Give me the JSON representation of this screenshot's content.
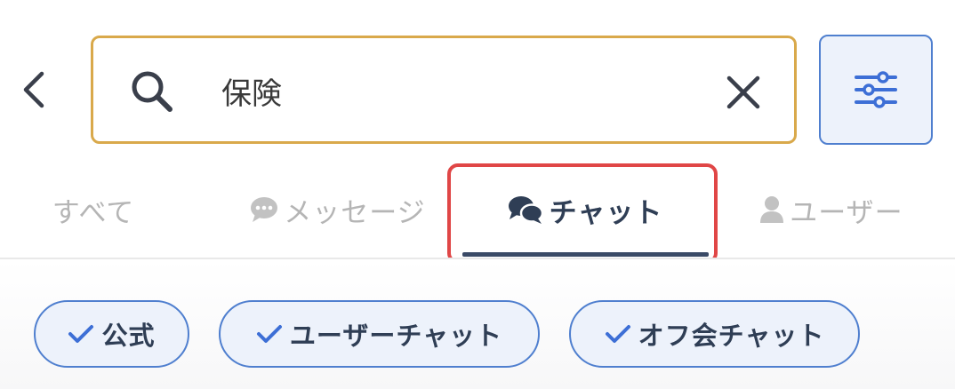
{
  "search": {
    "value": "保険",
    "placeholder": ""
  },
  "tabs": [
    {
      "label": "すべて",
      "icon": "",
      "selected": false
    },
    {
      "label": "メッセージ",
      "icon": "speech-bubble-icon",
      "selected": false
    },
    {
      "label": "チャット",
      "icon": "chat-bubbles-icon",
      "selected": true
    },
    {
      "label": "ユーザー",
      "icon": "person-icon",
      "selected": false
    }
  ],
  "chips": [
    {
      "label": "公式",
      "checked": true
    },
    {
      "label": "ユーザーチャット",
      "checked": true
    },
    {
      "label": "オフ会チャット",
      "checked": true
    }
  ],
  "colors": {
    "search_border": "#d9a94b",
    "accent_blue": "#4f7fcf",
    "chip_bg": "#edf2fb",
    "text_dark": "#2f3e55",
    "text_inactive": "#b5b5b5",
    "highlight_red": "#e04646"
  }
}
